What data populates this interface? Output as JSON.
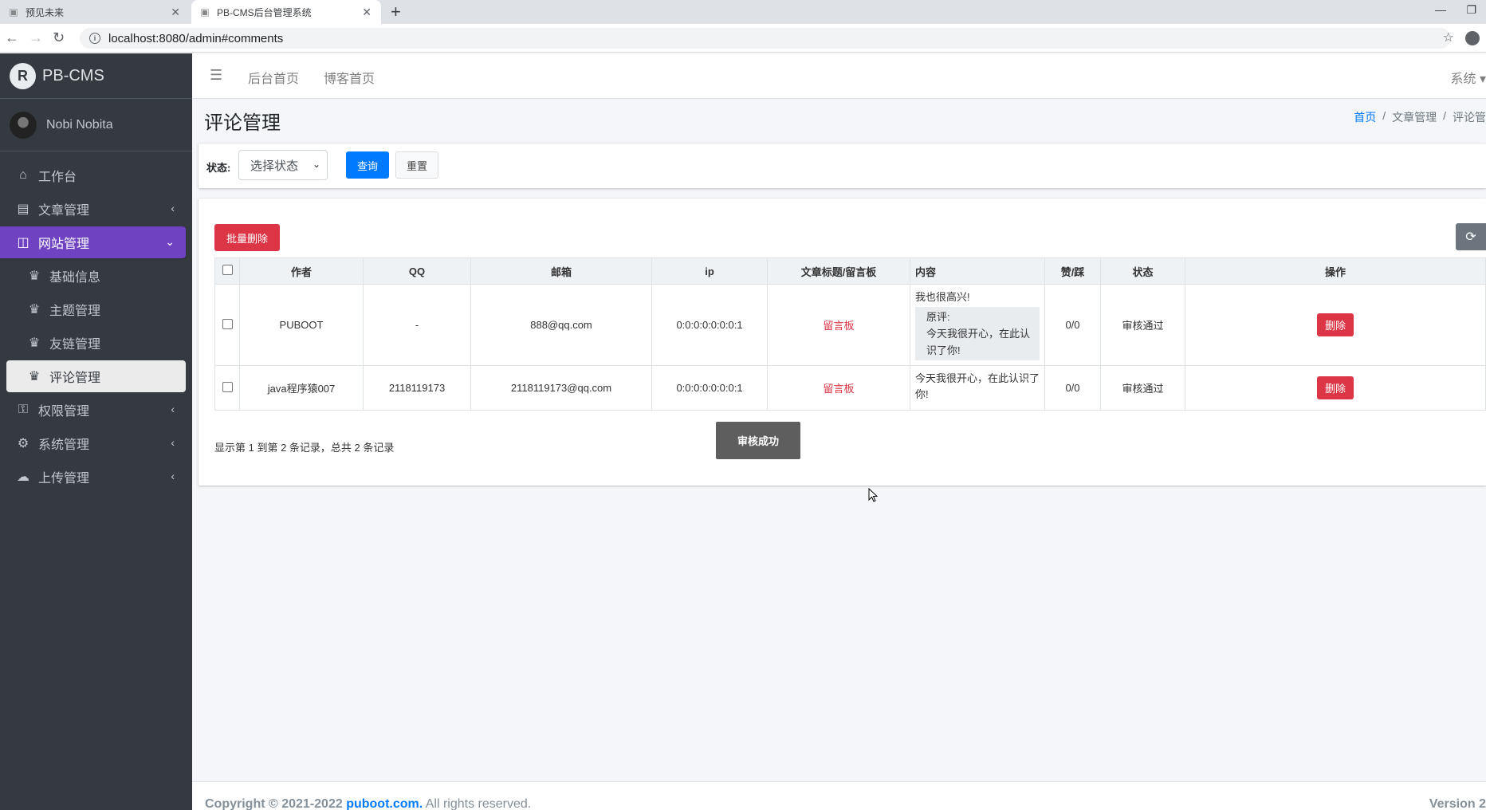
{
  "browser": {
    "tabs": [
      {
        "title": "预见未来"
      },
      {
        "title": "PB-CMS后台管理系统"
      }
    ],
    "url": "localhost:8080/admin#comments"
  },
  "sidebar": {
    "brand": "PB-CMS",
    "user": "Nobi Nobita",
    "items": [
      {
        "label": "工作台",
        "icon": "home-icon"
      },
      {
        "label": "文章管理",
        "icon": "list-icon"
      },
      {
        "label": "网站管理",
        "icon": "columns-icon"
      },
      {
        "label": "基础信息",
        "icon": "crown-icon"
      },
      {
        "label": "主题管理",
        "icon": "crown-icon"
      },
      {
        "label": "友链管理",
        "icon": "crown-icon"
      },
      {
        "label": "评论管理",
        "icon": "crown-icon"
      },
      {
        "label": "权限管理",
        "icon": "user-lock-icon"
      },
      {
        "label": "系统管理",
        "icon": "gear-icon"
      },
      {
        "label": "上传管理",
        "icon": "cloud-upload-icon"
      }
    ]
  },
  "topnav": {
    "link1": "后台首页",
    "link2": "博客首页",
    "system": "系统"
  },
  "page": {
    "title": "评论管理",
    "breadcrumb": [
      "首页",
      "文章管理",
      "评论管"
    ]
  },
  "filter": {
    "label": "状态:",
    "select_value": "选择状态",
    "query": "查询",
    "reset": "重置"
  },
  "table": {
    "batch_delete": "批量删除",
    "headers": [
      "作者",
      "QQ",
      "邮箱",
      "ip",
      "文章标题/留言板",
      "内容",
      "赞/踩",
      "状态",
      "操作"
    ],
    "rows": [
      {
        "author": "PUBOOT",
        "qq": "-",
        "email": "888@qq.com",
        "ip": "0:0:0:0:0:0:0:1",
        "title": "留言板",
        "content": "我也很高兴!",
        "quote_label": "原评:",
        "quote_text": "今天我很开心，在此认识了你!",
        "votes": "0/0",
        "status": "审核通过",
        "action": "删除"
      },
      {
        "author": "java程序猿007",
        "qq": "2118119173",
        "email": "2118119173@qq.com",
        "ip": "0:0:0:0:0:0:0:1",
        "title": "留言板",
        "content": "今天我很开心，在此认识了你!",
        "votes": "0/0",
        "status": "审核通过",
        "action": "删除"
      }
    ],
    "pager": "显示第 1 到第 2 条记录，总共 2 条记录"
  },
  "toast": "审核成功",
  "footer": {
    "copyright": "Copyright © 2021-2022",
    "site": "puboot.com.",
    "rights": "All rights reserved.",
    "version": "Version 2"
  }
}
